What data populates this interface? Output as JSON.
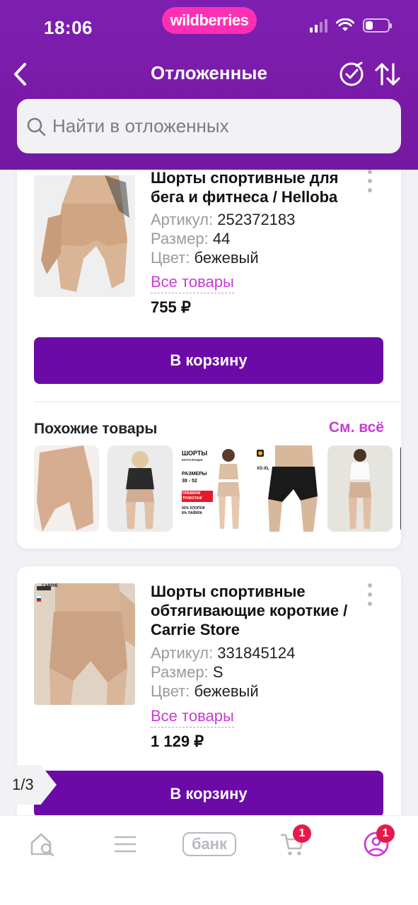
{
  "status_bar": {
    "time": "18:06",
    "brand": "wildberries"
  },
  "header": {
    "title": "Отложенные"
  },
  "search": {
    "placeholder": "Найти в отложенных"
  },
  "products": [
    {
      "title": "Шорты спортивные для бега и фитнеса / Helloba",
      "article_label": "Артикул:",
      "article": "252372183",
      "size_label": "Размер:",
      "size": "44",
      "color_label": "Цвет:",
      "color": "бежевый",
      "all_goods": "Все товары",
      "price": "755 ₽",
      "cart_button": "В корзину"
    },
    {
      "title": "Шорты спортивные обтягивающие короткие / Carrie Store",
      "article_label": "Артикул:",
      "article": "331845124",
      "size_label": "Размер:",
      "size": "S",
      "color_label": "Цвет:",
      "color": "бежевый",
      "all_goods": "Все товары",
      "price": "1 129 ₽",
      "cart_button": "В корзину",
      "image_brand": "CARRIE"
    }
  ],
  "similar": {
    "title": "Похожие товары",
    "see_all": "См. всё",
    "thumb3_lines": [
      "ШОРТЫ",
      "велосипедки",
      "РАЗМЕРЫ",
      "38 - 52",
      "ПРЕМИУМ ТРИКОТАЖ",
      "92% ХЛОПОК",
      "8% ЛАЙКРА"
    ],
    "thumb4_label": "XS-XL"
  },
  "pager": {
    "text": "1/3"
  },
  "bottom_nav": {
    "bank_label": "банк",
    "cart_badge": "1",
    "profile_badge": "1"
  },
  "colors": {
    "header_purple": "#7a1aa8",
    "button_purple": "#6c0aa8",
    "accent_pink": "#c93bd6",
    "brand_pink": "#ff2fb5",
    "badge_red": "#e51a4b"
  }
}
